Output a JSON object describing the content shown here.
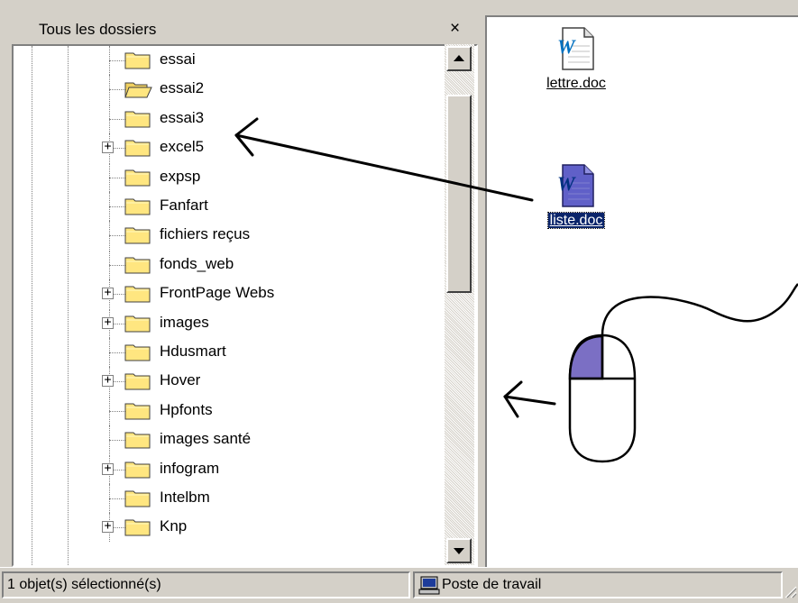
{
  "tree_panel": {
    "title": "Tous les dossiers",
    "close_glyph": "×",
    "items": [
      {
        "label": "essai",
        "expandable": false,
        "open": false
      },
      {
        "label": "essai2",
        "expandable": false,
        "open": true
      },
      {
        "label": "essai3",
        "expandable": false,
        "open": false
      },
      {
        "label": "excel5",
        "expandable": true,
        "open": false
      },
      {
        "label": "expsp",
        "expandable": false,
        "open": false
      },
      {
        "label": "Fanfart",
        "expandable": false,
        "open": false
      },
      {
        "label": "fichiers reçus",
        "expandable": false,
        "open": false
      },
      {
        "label": "fonds_web",
        "expandable": false,
        "open": false
      },
      {
        "label": "FrontPage Webs",
        "expandable": true,
        "open": false
      },
      {
        "label": "images",
        "expandable": true,
        "open": false
      },
      {
        "label": "Hdusmart",
        "expandable": false,
        "open": false
      },
      {
        "label": "Hover",
        "expandable": true,
        "open": false
      },
      {
        "label": "Hpfonts",
        "expandable": false,
        "open": false
      },
      {
        "label": "images santé",
        "expandable": false,
        "open": false
      },
      {
        "label": "infogram",
        "expandable": true,
        "open": false
      },
      {
        "label": "Intelbm",
        "expandable": false,
        "open": false
      },
      {
        "label": "Knp",
        "expandable": true,
        "open": false
      }
    ],
    "expander_glyph": "+"
  },
  "files_panel": {
    "files": [
      {
        "name": "lettre.doc",
        "icon": "word-document-icon",
        "selected": false
      },
      {
        "name": "liste.doc",
        "icon": "word-document-icon",
        "selected": true
      }
    ]
  },
  "statusbar": {
    "selection_text": "1 objet(s) sélectionné(s)",
    "location_text": "Poste de travail",
    "location_icon": "computer-icon"
  },
  "colors": {
    "window_bg": "#d4d0c8",
    "selection_bg": "#0a246a",
    "folder_yellow": "#ffe680",
    "mouse_button_highlight": "#7b6fc4",
    "word_icon_blue": "#6060c8"
  }
}
